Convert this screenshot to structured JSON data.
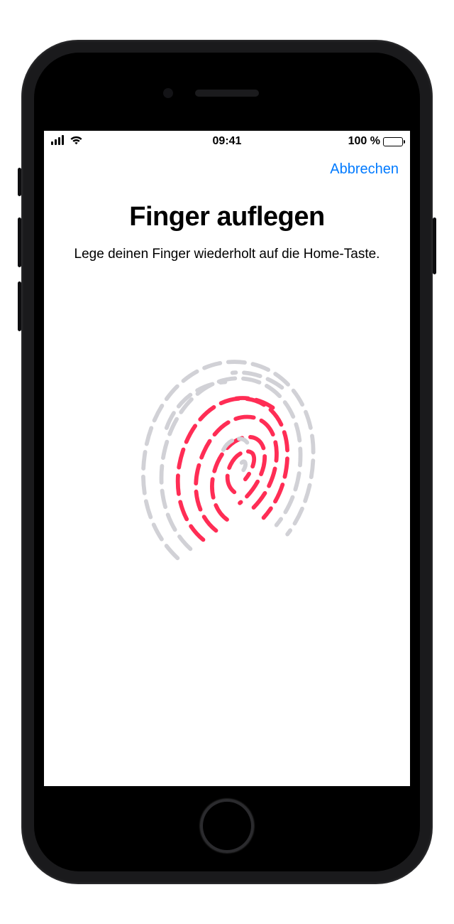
{
  "status_bar": {
    "time": "09:41",
    "battery_text": "100 %"
  },
  "nav": {
    "cancel_label": "Abbrechen"
  },
  "content": {
    "title": "Finger auflegen",
    "subtitle": "Lege deinen Finger wiederholt auf die Home-Taste."
  },
  "colors": {
    "accent_link": "#007aff",
    "fingerprint_active": "#ff2d55",
    "fingerprint_idle": "#d1d1d6"
  }
}
